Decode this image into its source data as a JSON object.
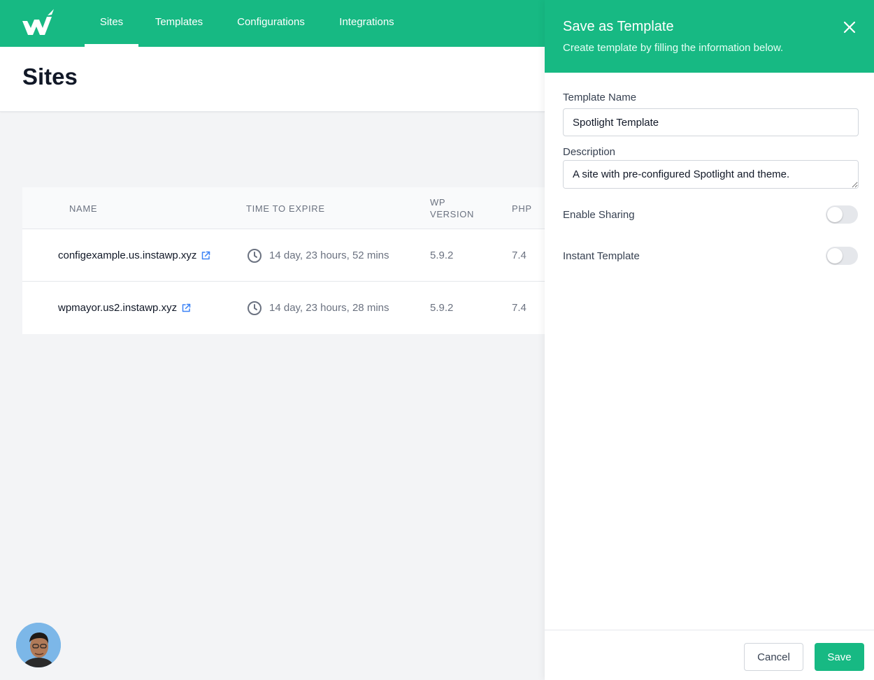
{
  "nav": {
    "items": [
      {
        "label": "Sites"
      },
      {
        "label": "Templates"
      },
      {
        "label": "Configurations"
      },
      {
        "label": "Integrations"
      }
    ]
  },
  "page": {
    "title": "Sites"
  },
  "table": {
    "headers": {
      "name": "NAME",
      "time_to_expire": "TIME TO EXPIRE",
      "wp_version_line1": "WP",
      "wp_version_line2": "VERSION",
      "php": "PHP"
    },
    "rows": [
      {
        "name": "configexample.us.instawp.xyz",
        "expire": "14 day, 23 hours, 52 mins",
        "wp": "5.9.2",
        "php": "7.4"
      },
      {
        "name": "wpmayor.us2.instawp.xyz",
        "expire": "14 day, 23 hours, 28 mins",
        "wp": "5.9.2",
        "php": "7.4"
      }
    ]
  },
  "panel": {
    "title": "Save as Template",
    "subtitle": "Create template by filling the information below.",
    "template_name_label": "Template Name",
    "template_name_value": "Spotlight Template",
    "description_label": "Description",
    "description_value": "A site with pre-configured Spotlight and theme.",
    "enable_sharing_label": "Enable Sharing",
    "enable_sharing": false,
    "instant_template_label": "Instant Template",
    "instant_template": false,
    "cancel_label": "Cancel",
    "save_label": "Save"
  },
  "colors": {
    "brand": "#17b983",
    "link_icon": "#3b82f6"
  }
}
